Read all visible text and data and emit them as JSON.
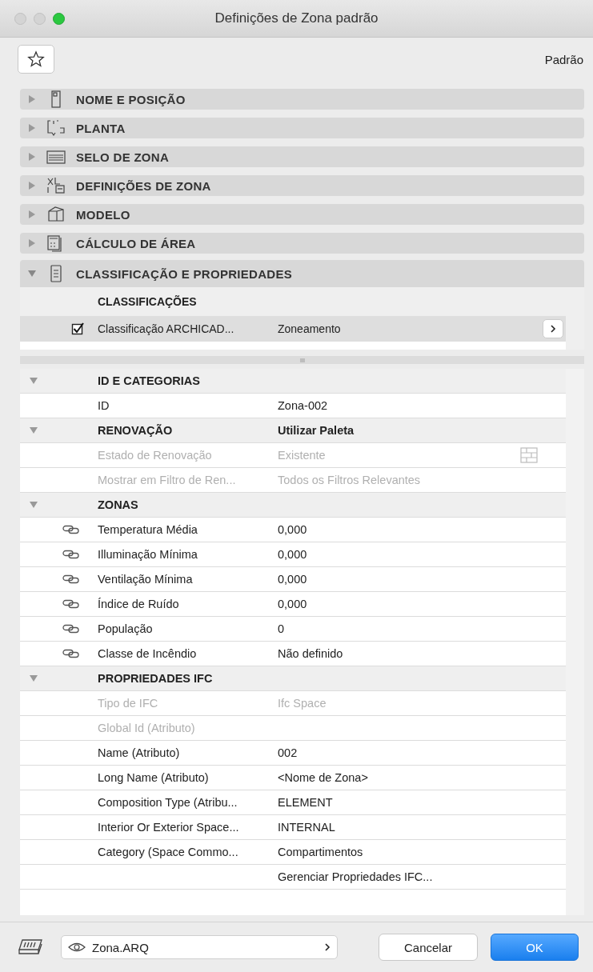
{
  "window": {
    "title": "Definições de Zona padrão"
  },
  "toolbar": {
    "preset": "Padrão"
  },
  "sections": [
    {
      "label": "NOME E POSIÇÃO",
      "expanded": false
    },
    {
      "label": "PLANTA",
      "expanded": false
    },
    {
      "label": "SELO DE ZONA",
      "expanded": false
    },
    {
      "label": "DEFINIÇÕES DE ZONA",
      "expanded": false
    },
    {
      "label": "MODELO",
      "expanded": false
    },
    {
      "label": "CÁLCULO DE ÁREA",
      "expanded": false
    },
    {
      "label": "CLASSIFICAÇÃO E PROPRIEDADES",
      "expanded": true
    }
  ],
  "classifications": {
    "title": "CLASSIFICAÇÕES",
    "rows": [
      {
        "checked": true,
        "selected": true,
        "name": "Classificação ARCHICAD...",
        "value": "Zoneamento"
      }
    ]
  },
  "property_groups": [
    {
      "title": "ID E CATEGORIAS",
      "expanded": true,
      "rows": [
        {
          "kind": "field",
          "name": "ID",
          "value": "Zona-002",
          "disabled": false
        }
      ]
    },
    {
      "title": "RENOVAÇÃO",
      "value": "Utilizar Paleta",
      "expanded": true,
      "rows": [
        {
          "kind": "palette",
          "name": "Estado de Renovação",
          "value": "Existente",
          "disabled": true
        },
        {
          "kind": "field",
          "name": "Mostrar em Filtro de Ren...",
          "value": "Todos os Filtros Relevantes",
          "disabled": true
        }
      ]
    },
    {
      "title": "ZONAS",
      "expanded": true,
      "rows": [
        {
          "kind": "linked",
          "name": "Temperatura Média",
          "value": "0,000",
          "disabled": false
        },
        {
          "kind": "linked",
          "name": "Illuminação Mínima",
          "value": "0,000",
          "disabled": false
        },
        {
          "kind": "linked",
          "name": "Ventilação Mínima",
          "value": "0,000",
          "disabled": false
        },
        {
          "kind": "linked",
          "name": "Índice de Ruído",
          "value": "0,000",
          "disabled": false
        },
        {
          "kind": "linked",
          "name": "População",
          "value": "0",
          "disabled": false
        },
        {
          "kind": "linked",
          "name": "Classe de Incêndio",
          "value": "Não definido",
          "disabled": false
        }
      ]
    },
    {
      "title": "PROPRIEDADES IFC",
      "expanded": true,
      "rows": [
        {
          "kind": "field",
          "name": "Tipo de IFC",
          "value": "Ifc Space",
          "disabled": true
        },
        {
          "kind": "field",
          "name": "Global Id (Atributo)",
          "disabled": true
        },
        {
          "kind": "field",
          "name": "Name (Atributo)",
          "value": "002",
          "disabled": false
        },
        {
          "kind": "field",
          "name": "Long Name (Atributo)",
          "value": "<Nome de Zona>",
          "disabled": false
        },
        {
          "kind": "field",
          "name": "Composition Type (Atribu...",
          "value": "ELEMENT",
          "disabled": false
        },
        {
          "kind": "field",
          "name": "Interior Or Exterior Space...",
          "value": "INTERNAL",
          "disabled": false
        },
        {
          "kind": "field",
          "name": "Category (Space Commo...",
          "value": "Compartimentos",
          "disabled": false
        },
        {
          "kind": "action",
          "value": "Gerenciar Propriedades IFC...",
          "disabled": false
        }
      ]
    }
  ],
  "footer": {
    "layer": "Zona.ARQ",
    "buttons": [
      {
        "label": "Cancelar",
        "kind": "cancel"
      },
      {
        "label": "OK",
        "kind": "default"
      }
    ]
  }
}
